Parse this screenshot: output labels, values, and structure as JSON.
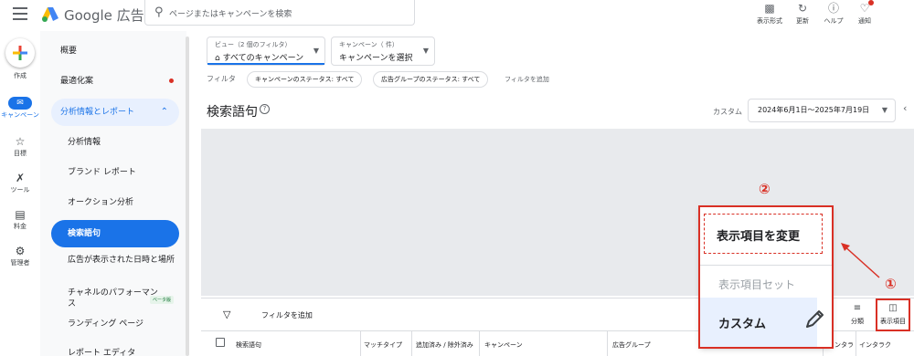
{
  "header": {
    "brand": "Google 広告",
    "search_placeholder": "ページまたはキャンペーンを検索",
    "toolbar": [
      {
        "label": "表示形式",
        "icon": "chart-bar-icon"
      },
      {
        "label": "更新",
        "icon": "refresh-icon"
      },
      {
        "label": "ヘルプ",
        "icon": "help-icon"
      },
      {
        "label": "通知",
        "icon": "bell-icon"
      }
    ]
  },
  "rail": {
    "create_label": "作成",
    "items": [
      {
        "label": "キャンペーン",
        "icon": "megaphone-icon",
        "active": true
      },
      {
        "label": "目標",
        "icon": "trophy-icon"
      },
      {
        "label": "ツール",
        "icon": "tools-icon"
      },
      {
        "label": "料金",
        "icon": "credit-card-icon"
      },
      {
        "label": "管理者",
        "icon": "gear-icon"
      }
    ]
  },
  "sidenav": {
    "overview": "概要",
    "recommendations": "最適化案",
    "analytics_group": "分析情報とレポート",
    "items": [
      "分析情報",
      "ブランド レポート",
      "オークション分析",
      "検索語句",
      "広告が表示された日時と場所",
      "チャネルのパフォーマンス",
      "ランディング ページ",
      "レポート エディタ"
    ],
    "beta_badge": "ベータ版"
  },
  "main": {
    "view_selector": {
      "caption": "ビュー（2 個のフィルタ）",
      "value": "すべてのキャンペーン"
    },
    "campaign_selector": {
      "caption": "キャンペーン（   件）",
      "value": "キャンペーンを選択"
    },
    "filter_label": "フィルタ",
    "filter_chips": [
      "キャンペーンのステータス: すべて",
      "広告グループのステータス: すべて"
    ],
    "add_filter": "フィルタを追加",
    "page_title": "検索語句",
    "date_custom_label": "カスタム",
    "date_range": "2024年6月1日～2025年7月19日"
  },
  "table": {
    "add_filter": "フィルタを追加",
    "segment_label": "分類",
    "columns_label": "表示項目",
    "headers": [
      "検索語句",
      "マッチタイプ",
      "追加済み / 除外済み",
      "キャンペーン",
      "広告グループ",
      "インタラ",
      "インタラク"
    ]
  },
  "popup": {
    "change_columns": "表示項目を変更",
    "column_sets": "表示項目セット",
    "custom": "カスタム"
  },
  "annotations": {
    "step1": "①",
    "step2": "②"
  },
  "colors": {
    "primary": "#1a73e8",
    "annotation_red": "#d93025"
  }
}
